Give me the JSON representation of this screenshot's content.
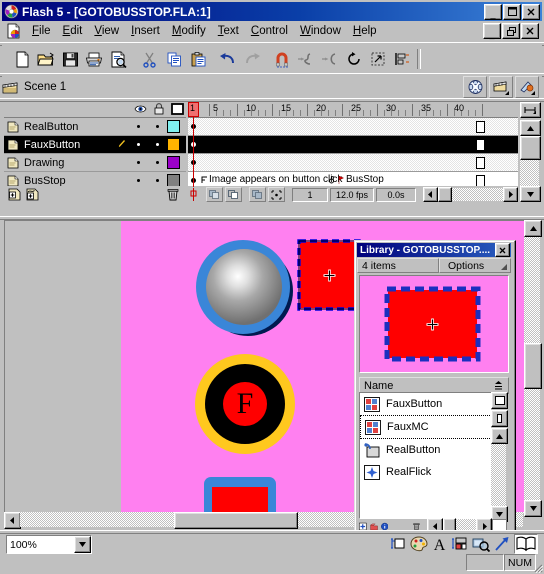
{
  "window": {
    "title": "Flash 5 - [GOTOBUSSTOP.FLA:1]",
    "app_icon": "flash-logo-icon",
    "minimize": "_",
    "maximize": "□",
    "close": "✕",
    "mdi_restore": "&",
    "mdi_minimize": "_",
    "mdi_close": "✕"
  },
  "menu": {
    "doc_icon": "document-flash-icon",
    "items": [
      {
        "label": "File",
        "accel": "F"
      },
      {
        "label": "Edit",
        "accel": "E"
      },
      {
        "label": "View",
        "accel": "V"
      },
      {
        "label": "Insert",
        "accel": "I"
      },
      {
        "label": "Modify",
        "accel": "M"
      },
      {
        "label": "Text",
        "accel": "T"
      },
      {
        "label": "Control",
        "accel": "C"
      },
      {
        "label": "Window",
        "accel": "W"
      },
      {
        "label": "Help",
        "accel": "H"
      }
    ]
  },
  "toolbar": {
    "buttons": [
      {
        "name": "new-file-icon",
        "tooltip": "New"
      },
      {
        "name": "open-folder-icon",
        "tooltip": "Open"
      },
      {
        "name": "save-disk-icon",
        "tooltip": "Save"
      },
      {
        "name": "print-icon",
        "tooltip": "Print"
      },
      {
        "name": "print-preview-icon",
        "tooltip": "Print Preview"
      },
      {
        "name": "cut-scissors-icon",
        "tooltip": "Cut"
      },
      {
        "name": "copy-icon",
        "tooltip": "Copy"
      },
      {
        "name": "paste-icon",
        "tooltip": "Paste"
      },
      {
        "name": "undo-arrow-icon",
        "tooltip": "Undo"
      },
      {
        "name": "redo-arrow-icon",
        "tooltip": "Redo"
      },
      {
        "name": "snap-magnet-icon",
        "tooltip": "Snap to Objects"
      },
      {
        "name": "smooth-icon",
        "tooltip": "Smooth"
      },
      {
        "name": "straighten-icon",
        "tooltip": "Straighten"
      },
      {
        "name": "rotate-icon",
        "tooltip": "Rotate"
      },
      {
        "name": "scale-icon",
        "tooltip": "Scale"
      },
      {
        "name": "align-icon",
        "tooltip": "Align"
      }
    ]
  },
  "scene_bar": {
    "icon": "scene-clapper-icon",
    "label": "Scene 1",
    "buttons": [
      {
        "name": "edit-movie-globe-icon"
      },
      {
        "name": "edit-scene-icon"
      },
      {
        "name": "edit-symbol-icon"
      }
    ]
  },
  "timeline": {
    "header_icons": [
      {
        "name": "eye-visibility-icon"
      },
      {
        "name": "padlock-icon"
      },
      {
        "name": "outline-square-icon"
      }
    ],
    "layers": [
      {
        "name": "RealButton",
        "color": "#7ff0f0",
        "selected": false,
        "pencil": false
      },
      {
        "name": "FauxButton",
        "color": "#ffb400",
        "selected": true,
        "pencil": true
      },
      {
        "name": "Drawing",
        "color": "#9a00c8",
        "selected": false,
        "pencil": false
      },
      {
        "name": "BusStop",
        "color": "#808080",
        "selected": false,
        "pencil": false
      }
    ],
    "layer_buttons": [
      {
        "name": "add-layer-icon"
      },
      {
        "name": "add-guide-layer-icon"
      },
      {
        "name": "delete-layer-trash-icon"
      }
    ],
    "ruler_marks": [
      1,
      5,
      10,
      15,
      20,
      25,
      30,
      35,
      40
    ],
    "current_frame_marker": "1",
    "frame_labels": [
      {
        "text": "Image appears on button click",
        "icon": "frame-label-icon"
      },
      {
        "text": "BusStop",
        "icon": "frame-anchor-icon"
      }
    ],
    "status": {
      "frame_number": "1",
      "fps": "12.0 fps",
      "elapsed": "0.0s"
    },
    "onion_buttons": [
      {
        "name": "onion-skin-icon"
      },
      {
        "name": "onion-skin-outlines-icon"
      },
      {
        "name": "edit-multiple-frames-icon"
      },
      {
        "name": "modify-onion-markers-icon"
      }
    ],
    "center_frame_button": {
      "name": "center-frame-icon"
    }
  },
  "stage": {
    "background_color": "#ff80f0",
    "workspace_color": "#c0c0c0",
    "objects": [
      {
        "name": "gray-gradient-ball",
        "type": "circle",
        "outer_color": "#3a86d8",
        "inner_color": "#9a9a9a",
        "highlight": "#ffffff"
      },
      {
        "name": "faux-button-f",
        "type": "circle",
        "ring_color": "#ffc81e",
        "body_color": "#000000",
        "center_color": "#ff0000",
        "label": "F"
      },
      {
        "name": "bus-stop-rect",
        "type": "rect",
        "frame_color": "#3a86d8",
        "fill_color": "#ff0000"
      },
      {
        "name": "selected-instance",
        "type": "rect",
        "fill_color": "#ff0000",
        "selection_color": "#0000ff",
        "registration": "+"
      }
    ]
  },
  "library": {
    "title": "Library - GOTOBUSSTOP....",
    "close_label": "✕",
    "item_count": "4 items",
    "options_label": "Options",
    "preview": {
      "background": "#ff80f0",
      "fill_color": "#ff0000",
      "selection_color": "#1a2fbf",
      "registration": "+"
    },
    "name_column_header": "Name",
    "sort_icon": "sort-order-icon",
    "items": [
      {
        "label": "FauxButton",
        "icon": "movie-clip-icon",
        "selected": false
      },
      {
        "label": "FauxMC",
        "icon": "movie-clip-icon",
        "selected": true
      },
      {
        "label": "RealButton",
        "icon": "button-symbol-icon",
        "selected": false
      },
      {
        "label": "RealFlick",
        "icon": "graphic-symbol-icon",
        "selected": false
      }
    ],
    "footer_buttons": [
      {
        "name": "new-symbol-icon"
      },
      {
        "name": "new-folder-icon"
      },
      {
        "name": "symbol-properties-icon"
      },
      {
        "name": "delete-symbol-trash-icon"
      }
    ],
    "list_view_buttons": [
      {
        "name": "wide-library-view-icon"
      },
      {
        "name": "narrow-library-view-icon"
      }
    ]
  },
  "status_bar": {
    "zoom_value": "100%",
    "zoom_dropdown_icon": "chevron-down-icon",
    "num_lock": "NUM",
    "panel_launchers": [
      {
        "name": "info-panel-icon"
      },
      {
        "name": "mixer-palette-icon"
      },
      {
        "name": "character-panel-icon"
      },
      {
        "name": "instance-panel-icon"
      },
      {
        "name": "movie-explorer-icon"
      },
      {
        "name": "actions-panel-icon"
      },
      {
        "name": "library-panel-icon"
      }
    ]
  }
}
